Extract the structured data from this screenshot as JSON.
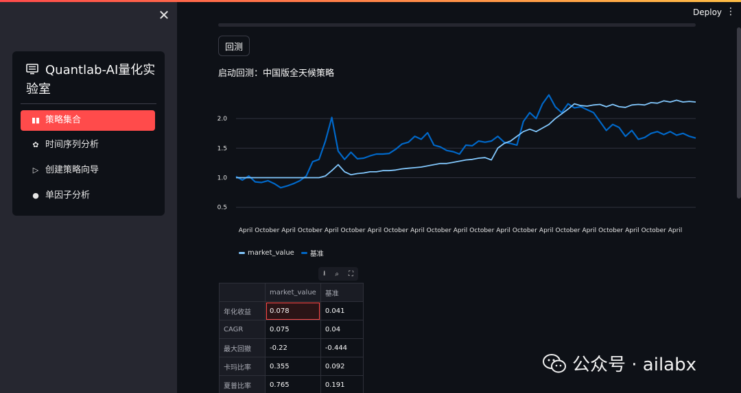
{
  "app": {
    "title": "Quantlab-AI量化实验室",
    "deploy_label": "Deploy",
    "menu_icon": "kebab-icon",
    "accent": "#ff4b4b"
  },
  "sidebar": {
    "close_icon": "close-icon",
    "title": "Quantlab-AI量化实验室",
    "items": [
      {
        "label": "策略集合",
        "icon": "bar-chart-icon",
        "active": true
      },
      {
        "label": "时间序列分析",
        "icon": "network-icon",
        "active": false
      },
      {
        "label": "创建策略向导",
        "icon": "play-icon",
        "active": false
      },
      {
        "label": "单因子分析",
        "icon": "globe-icon",
        "active": false
      }
    ]
  },
  "main": {
    "backtest_button": "回测",
    "status_text": "启动回测：中国版全天候策略"
  },
  "chart_data": {
    "type": "line",
    "y_ticks": [
      "0.5",
      "1.0",
      "1.5",
      "2.0"
    ],
    "ylim": [
      0.3,
      2.5
    ],
    "x_ticks": [
      "April",
      "October",
      "April",
      "October",
      "April",
      "October",
      "April",
      "October",
      "April",
      "October",
      "April",
      "October",
      "April",
      "October",
      "April",
      "October",
      "April",
      "October",
      "April",
      "October",
      "April"
    ],
    "grid": true,
    "legend_position": "bottom-left",
    "series": [
      {
        "name": "market_value",
        "color": "#83c9ff",
        "values": [
          1.0,
          1.0,
          1.0,
          1.0,
          1.0,
          1.0,
          1.0,
          1.0,
          1.0,
          1.0,
          1.0,
          1.0,
          1.0,
          1.0,
          1.03,
          1.12,
          1.22,
          1.1,
          1.05,
          1.07,
          1.08,
          1.1,
          1.1,
          1.12,
          1.12,
          1.13,
          1.15,
          1.16,
          1.17,
          1.18,
          1.2,
          1.22,
          1.24,
          1.24,
          1.26,
          1.28,
          1.3,
          1.31,
          1.33,
          1.34,
          1.3,
          1.5,
          1.58,
          1.62,
          1.7,
          1.78,
          1.82,
          1.78,
          1.84,
          1.9,
          2.0,
          2.08,
          2.16,
          2.25,
          2.22,
          2.21,
          2.23,
          2.24,
          2.2,
          2.24,
          2.2,
          2.19,
          2.23,
          2.24,
          2.23,
          2.27,
          2.26,
          2.3,
          2.28,
          2.31,
          2.28,
          2.29,
          2.28
        ]
      },
      {
        "name": "基准",
        "color": "#0068c9",
        "values": [
          1.02,
          0.96,
          1.03,
          0.93,
          0.92,
          0.95,
          0.9,
          0.83,
          0.86,
          0.9,
          0.95,
          1.03,
          1.27,
          1.31,
          1.62,
          2.02,
          1.45,
          1.31,
          1.43,
          1.32,
          1.33,
          1.37,
          1.4,
          1.4,
          1.41,
          1.48,
          1.57,
          1.6,
          1.7,
          1.65,
          1.76,
          1.55,
          1.52,
          1.46,
          1.44,
          1.4,
          1.55,
          1.54,
          1.62,
          1.6,
          1.62,
          1.7,
          1.6,
          1.58,
          1.55,
          1.95,
          2.1,
          2.0,
          2.25,
          2.4,
          2.2,
          2.1,
          2.25,
          2.18,
          2.2,
          2.15,
          2.1,
          1.95,
          1.8,
          1.9,
          1.85,
          1.7,
          1.8,
          1.65,
          1.68,
          1.75,
          1.78,
          1.73,
          1.78,
          1.72,
          1.75,
          1.7,
          1.67
        ]
      }
    ]
  },
  "table": {
    "toolbar": [
      {
        "icon": "download-icon",
        "glyph": "⭳"
      },
      {
        "icon": "search-icon",
        "glyph": "⌕"
      },
      {
        "icon": "fullscreen-icon",
        "glyph": "⛶"
      }
    ],
    "headers": [
      "",
      "market_value",
      "基准"
    ],
    "rows": [
      {
        "label": "年化收益",
        "market_value": "0.078",
        "benchmark": "0.041"
      },
      {
        "label": "CAGR",
        "market_value": "0.075",
        "benchmark": "0.04"
      },
      {
        "label": "最大回撤",
        "market_value": "-0.22",
        "benchmark": "-0.444"
      },
      {
        "label": "卡玛比率",
        "market_value": "0.355",
        "benchmark": "0.092"
      },
      {
        "label": "夏普比率",
        "market_value": "0.765",
        "benchmark": "0.191"
      }
    ]
  },
  "watermark": {
    "text": "公众号 · ailabx",
    "icon": "wechat-icon"
  }
}
